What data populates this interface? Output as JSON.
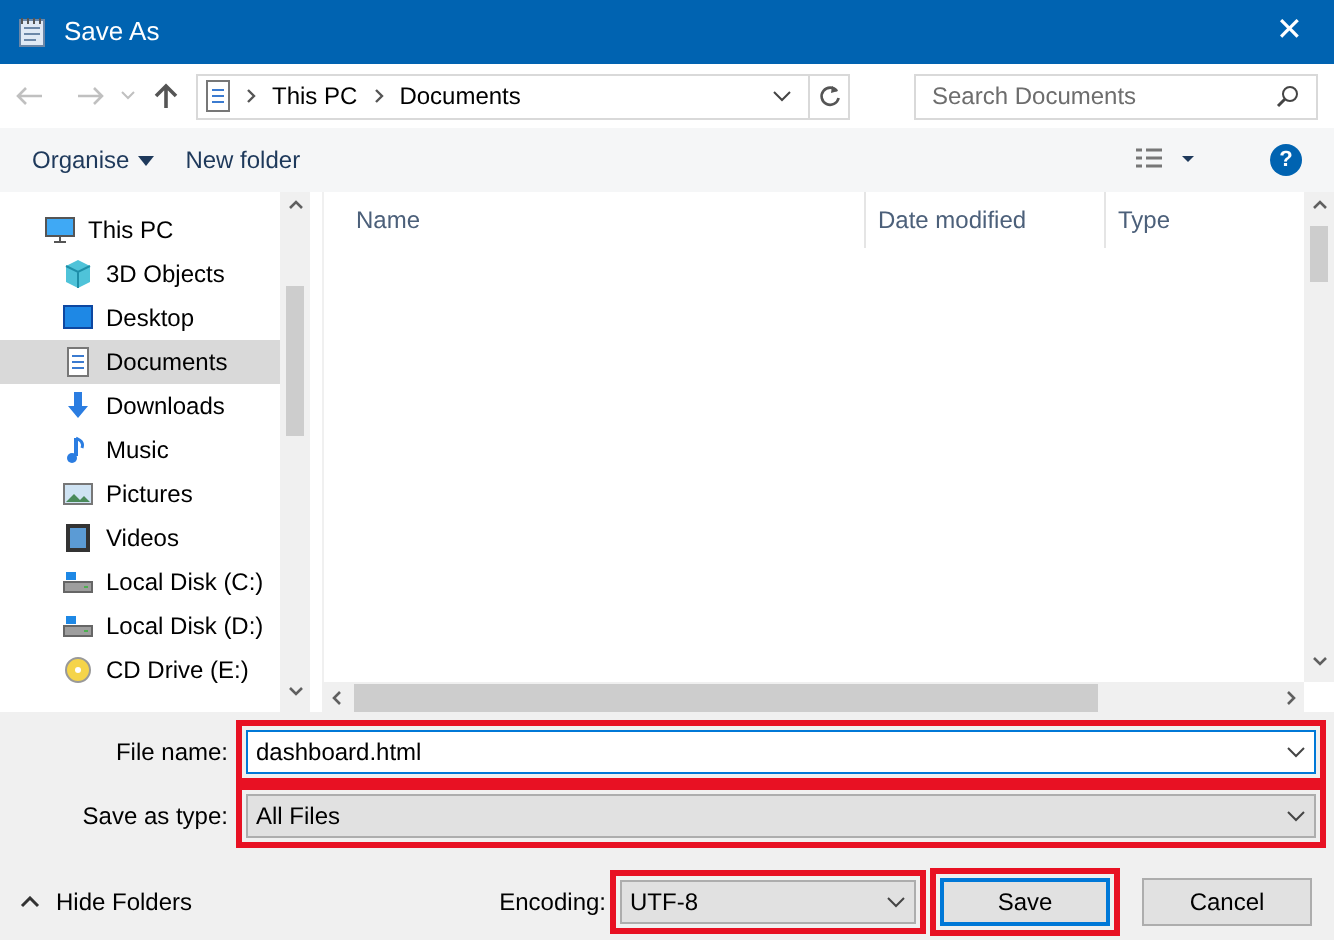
{
  "window": {
    "title": "Save As",
    "close": "✕"
  },
  "address_bar": {
    "path": [
      "This PC",
      "Documents"
    ]
  },
  "search": {
    "placeholder": "Search Documents"
  },
  "toolbar": {
    "organise": "Organise",
    "new_folder": "New folder",
    "help": "?"
  },
  "sidebar": {
    "items": [
      {
        "label": "This PC",
        "kind": "pc",
        "selected": false
      },
      {
        "label": "3D Objects",
        "kind": "cube",
        "selected": false
      },
      {
        "label": "Desktop",
        "kind": "desktop",
        "selected": false
      },
      {
        "label": "Documents",
        "kind": "doc",
        "selected": true
      },
      {
        "label": "Downloads",
        "kind": "download",
        "selected": false
      },
      {
        "label": "Music",
        "kind": "music",
        "selected": false
      },
      {
        "label": "Pictures",
        "kind": "picture",
        "selected": false
      },
      {
        "label": "Videos",
        "kind": "video",
        "selected": false
      },
      {
        "label": "Local Disk (C:)",
        "kind": "disk",
        "selected": false
      },
      {
        "label": "Local Disk (D:)",
        "kind": "disk",
        "selected": false
      },
      {
        "label": "CD Drive (E:)",
        "kind": "cd",
        "selected": false
      }
    ]
  },
  "file_list": {
    "columns": [
      "Name",
      "Date modified",
      "Type"
    ]
  },
  "form": {
    "file_name_label": "File name:",
    "file_name": "dashboard.html",
    "file_name_highlighted": true,
    "type_label": "Save as type:",
    "type": "All Files",
    "type_highlighted": true,
    "encoding_label": "Encoding:",
    "encoding": "UTF-8",
    "encoding_highlighted": true
  },
  "hide_folders": "Hide Folders",
  "buttons": [
    {
      "label": "Save",
      "default": true,
      "highlighted": true
    },
    {
      "label": "Cancel",
      "default": false,
      "highlighted": false
    }
  ]
}
